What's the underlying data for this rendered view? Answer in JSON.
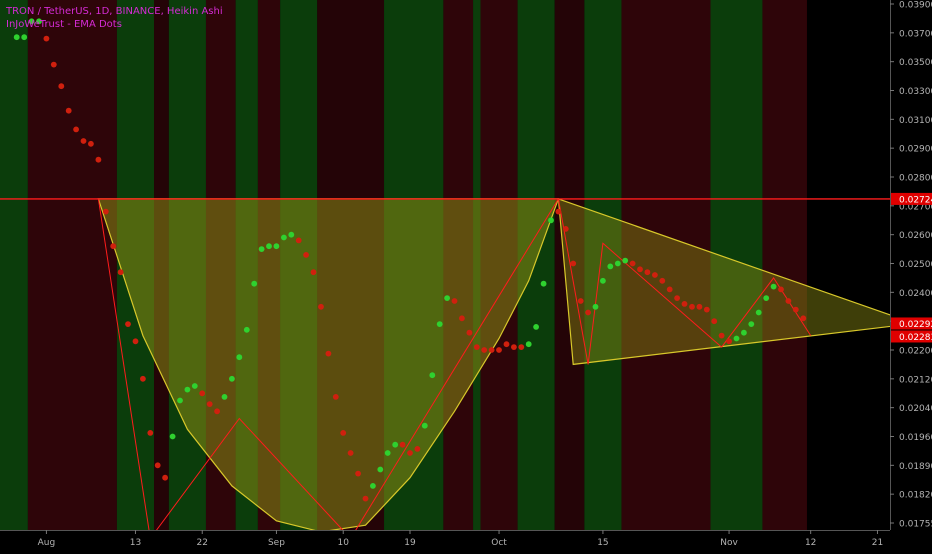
{
  "header": {
    "symbol_line": "TRON / TetherUS, 1D, BINANCE, Heikin Ashi",
    "indicator_line": "InJoWeTrust - EMA Dots"
  },
  "colors": {
    "text_magenta": "#d42bd4",
    "axis_text": "#b3b3b3",
    "dot_green": "#2fd12f",
    "dot_red": "#d0200e",
    "band_green": "#0b3d0b",
    "band_green_bright": "#0f4a10",
    "band_red": "#2e0509",
    "band_red_dark": "#240407",
    "resistance": "#ff1c1c",
    "cup_fill": "#8a8a14",
    "pattern_stroke": "#d8c82a",
    "price_badge": "#e00000"
  },
  "chart_data": {
    "type": "scatter",
    "title": "",
    "series": [
      {
        "name": "",
        "kind": "Heikin Ashi EMA dots"
      }
    ],
    "y_axis": {
      "position": "right",
      "range": [
        0.01735,
        0.0391
      ],
      "tick_labels": [
        "0.03900",
        "0.03700",
        "0.03500",
        "0.03300",
        "0.03100",
        "0.02900",
        "0.02800",
        "0.02700",
        "0.02600",
        "0.02500",
        "0.02400",
        "0.02300",
        "0.02200",
        "0.02120",
        "0.02040",
        "0.01960",
        "0.01890",
        "0.01820",
        "0.01755"
      ],
      "tick_values": [
        0.039,
        0.037,
        0.035,
        0.033,
        0.031,
        0.029,
        0.028,
        0.027,
        0.026,
        0.025,
        0.024,
        0.023,
        0.022,
        0.0212,
        0.0204,
        0.0196,
        0.0189,
        0.0182,
        0.01755
      ],
      "price_badges": [
        "0.02724",
        "0.02292",
        "0.02283"
      ],
      "price_badge_values": [
        0.02724,
        0.02292,
        0.02283
      ]
    },
    "x_axis": {
      "labels": [
        "Aug",
        "13",
        "22",
        "Sep",
        "10",
        "19",
        "Oct",
        "15",
        "Nov",
        "12",
        "21"
      ],
      "label_dates": [
        "2018-08-01",
        "2018-08-13",
        "2018-08-22",
        "2018-09-01",
        "2018-09-10",
        "2018-09-19",
        "2018-10-01",
        "2018-10-15",
        "2018-11-01",
        "2018-11-12",
        "2018-11-21"
      ]
    },
    "horizontal_line": {
      "value": 0.02724
    },
    "background_bands": [
      {
        "from": "2018-07-28",
        "to": "2018-07-30",
        "color": "green"
      },
      {
        "from": "2018-07-30",
        "to": "2018-08-11",
        "color": "red"
      },
      {
        "from": "2018-08-11",
        "to": "2018-08-16",
        "color": "green"
      },
      {
        "from": "2018-08-16",
        "to": "2018-08-18",
        "color": "red"
      },
      {
        "from": "2018-08-18",
        "to": "2018-08-23",
        "color": "green"
      },
      {
        "from": "2018-08-23",
        "to": "2018-08-27",
        "color": "red"
      },
      {
        "from": "2018-08-27",
        "to": "2018-08-30",
        "color": "green"
      },
      {
        "from": "2018-08-30",
        "to": "2018-09-02",
        "color": "red"
      },
      {
        "from": "2018-09-02",
        "to": "2018-09-07",
        "color": "green"
      },
      {
        "from": "2018-09-07",
        "to": "2018-09-16",
        "color": "red"
      },
      {
        "from": "2018-09-16",
        "to": "2018-09-24",
        "color": "green"
      },
      {
        "from": "2018-09-24",
        "to": "2018-09-28",
        "color": "red"
      },
      {
        "from": "2018-09-28",
        "to": "2018-09-29",
        "color": "green"
      },
      {
        "from": "2018-09-29",
        "to": "2018-10-04",
        "color": "red"
      },
      {
        "from": "2018-10-04",
        "to": "2018-10-09",
        "color": "green"
      },
      {
        "from": "2018-10-09",
        "to": "2018-10-13",
        "color": "red"
      },
      {
        "from": "2018-10-13",
        "to": "2018-10-18",
        "color": "green"
      },
      {
        "from": "2018-10-18",
        "to": "2018-10-30",
        "color": "red"
      },
      {
        "from": "2018-10-30",
        "to": "2018-11-06",
        "color": "green"
      },
      {
        "from": "2018-11-06",
        "to": "2018-11-12",
        "color": "red"
      }
    ],
    "dots": [
      {
        "date": "2018-07-28",
        "value": 0.0367,
        "color": "green"
      },
      {
        "date": "2018-07-29",
        "value": 0.0367,
        "color": "green"
      },
      {
        "date": "2018-07-30",
        "value": 0.0378,
        "color": "green"
      },
      {
        "date": "2018-07-31",
        "value": 0.0378,
        "color": "green"
      },
      {
        "date": "2018-08-01",
        "value": 0.0366,
        "color": "red"
      },
      {
        "date": "2018-08-02",
        "value": 0.0348,
        "color": "red"
      },
      {
        "date": "2018-08-03",
        "value": 0.0333,
        "color": "red"
      },
      {
        "date": "2018-08-04",
        "value": 0.0316,
        "color": "red"
      },
      {
        "date": "2018-08-05",
        "value": 0.0303,
        "color": "red"
      },
      {
        "date": "2018-08-06",
        "value": 0.0295,
        "color": "red"
      },
      {
        "date": "2018-08-07",
        "value": 0.0293,
        "color": "red"
      },
      {
        "date": "2018-08-08",
        "value": 0.0286,
        "color": "red"
      },
      {
        "date": "2018-08-09",
        "value": 0.0268,
        "color": "red"
      },
      {
        "date": "2018-08-10",
        "value": 0.0256,
        "color": "red"
      },
      {
        "date": "2018-08-11",
        "value": 0.0247,
        "color": "red"
      },
      {
        "date": "2018-08-12",
        "value": 0.0229,
        "color": "red"
      },
      {
        "date": "2018-08-13",
        "value": 0.0223,
        "color": "red"
      },
      {
        "date": "2018-08-14",
        "value": 0.0212,
        "color": "red"
      },
      {
        "date": "2018-08-15",
        "value": 0.0197,
        "color": "red"
      },
      {
        "date": "2018-08-16",
        "value": 0.0189,
        "color": "red"
      },
      {
        "date": "2018-08-17",
        "value": 0.0186,
        "color": "red"
      },
      {
        "date": "2018-08-18",
        "value": 0.0196,
        "color": "green"
      },
      {
        "date": "2018-08-19",
        "value": 0.0206,
        "color": "green"
      },
      {
        "date": "2018-08-20",
        "value": 0.0209,
        "color": "green"
      },
      {
        "date": "2018-08-21",
        "value": 0.021,
        "color": "green"
      },
      {
        "date": "2018-08-22",
        "value": 0.0208,
        "color": "red"
      },
      {
        "date": "2018-08-23",
        "value": 0.0205,
        "color": "red"
      },
      {
        "date": "2018-08-24",
        "value": 0.0203,
        "color": "red"
      },
      {
        "date": "2018-08-25",
        "value": 0.0207,
        "color": "green"
      },
      {
        "date": "2018-08-26",
        "value": 0.0212,
        "color": "green"
      },
      {
        "date": "2018-08-27",
        "value": 0.0218,
        "color": "green"
      },
      {
        "date": "2018-08-28",
        "value": 0.0227,
        "color": "green"
      },
      {
        "date": "2018-08-29",
        "value": 0.0243,
        "color": "green"
      },
      {
        "date": "2018-08-30",
        "value": 0.0255,
        "color": "green"
      },
      {
        "date": "2018-08-31",
        "value": 0.0256,
        "color": "green"
      },
      {
        "date": "2018-09-01",
        "value": 0.0256,
        "color": "green"
      },
      {
        "date": "2018-09-02",
        "value": 0.0259,
        "color": "green"
      },
      {
        "date": "2018-09-03",
        "value": 0.026,
        "color": "green"
      },
      {
        "date": "2018-09-04",
        "value": 0.0258,
        "color": "red"
      },
      {
        "date": "2018-09-05",
        "value": 0.0253,
        "color": "red"
      },
      {
        "date": "2018-09-06",
        "value": 0.0247,
        "color": "red"
      },
      {
        "date": "2018-09-07",
        "value": 0.0235,
        "color": "red"
      },
      {
        "date": "2018-09-08",
        "value": 0.0219,
        "color": "red"
      },
      {
        "date": "2018-09-09",
        "value": 0.0207,
        "color": "red"
      },
      {
        "date": "2018-09-10",
        "value": 0.0197,
        "color": "red"
      },
      {
        "date": "2018-09-11",
        "value": 0.0192,
        "color": "red"
      },
      {
        "date": "2018-09-12",
        "value": 0.0187,
        "color": "red"
      },
      {
        "date": "2018-09-13",
        "value": 0.0181,
        "color": "red"
      },
      {
        "date": "2018-09-14",
        "value": 0.0184,
        "color": "green"
      },
      {
        "date": "2018-09-15",
        "value": 0.0188,
        "color": "green"
      },
      {
        "date": "2018-09-16",
        "value": 0.0192,
        "color": "green"
      },
      {
        "date": "2018-09-17",
        "value": 0.0194,
        "color": "green"
      },
      {
        "date": "2018-09-18",
        "value": 0.0194,
        "color": "red"
      },
      {
        "date": "2018-09-19",
        "value": 0.0192,
        "color": "red"
      },
      {
        "date": "2018-09-20",
        "value": 0.0193,
        "color": "red"
      },
      {
        "date": "2018-09-21",
        "value": 0.0199,
        "color": "green"
      },
      {
        "date": "2018-09-22",
        "value": 0.0213,
        "color": "green"
      },
      {
        "date": "2018-09-23",
        "value": 0.0229,
        "color": "green"
      },
      {
        "date": "2018-09-24",
        "value": 0.0238,
        "color": "green"
      },
      {
        "date": "2018-09-25",
        "value": 0.0237,
        "color": "red"
      },
      {
        "date": "2018-09-26",
        "value": 0.0231,
        "color": "red"
      },
      {
        "date": "2018-09-27",
        "value": 0.0226,
        "color": "red"
      },
      {
        "date": "2018-09-28",
        "value": 0.0221,
        "color": "red"
      },
      {
        "date": "2018-09-29",
        "value": 0.022,
        "color": "red"
      },
      {
        "date": "2018-09-30",
        "value": 0.022,
        "color": "red"
      },
      {
        "date": "2018-10-01",
        "value": 0.022,
        "color": "red"
      },
      {
        "date": "2018-10-02",
        "value": 0.0222,
        "color": "red"
      },
      {
        "date": "2018-10-03",
        "value": 0.0221,
        "color": "red"
      },
      {
        "date": "2018-10-04",
        "value": 0.0221,
        "color": "red"
      },
      {
        "date": "2018-10-05",
        "value": 0.0222,
        "color": "green"
      },
      {
        "date": "2018-10-06",
        "value": 0.0228,
        "color": "green"
      },
      {
        "date": "2018-10-07",
        "value": 0.0243,
        "color": "green"
      },
      {
        "date": "2018-10-08",
        "value": 0.0265,
        "color": "green"
      },
      {
        "date": "2018-10-09",
        "value": 0.0268,
        "color": "red"
      },
      {
        "date": "2018-10-10",
        "value": 0.0262,
        "color": "red"
      },
      {
        "date": "2018-10-11",
        "value": 0.025,
        "color": "red"
      },
      {
        "date": "2018-10-12",
        "value": 0.0237,
        "color": "red"
      },
      {
        "date": "2018-10-13",
        "value": 0.0233,
        "color": "red"
      },
      {
        "date": "2018-10-14",
        "value": 0.0235,
        "color": "green"
      },
      {
        "date": "2018-10-15",
        "value": 0.0244,
        "color": "green"
      },
      {
        "date": "2018-10-16",
        "value": 0.0249,
        "color": "green"
      },
      {
        "date": "2018-10-17",
        "value": 0.025,
        "color": "green"
      },
      {
        "date": "2018-10-18",
        "value": 0.0251,
        "color": "green"
      },
      {
        "date": "2018-10-19",
        "value": 0.025,
        "color": "red"
      },
      {
        "date": "2018-10-20",
        "value": 0.0248,
        "color": "red"
      },
      {
        "date": "2018-10-21",
        "value": 0.0247,
        "color": "red"
      },
      {
        "date": "2018-10-22",
        "value": 0.0246,
        "color": "red"
      },
      {
        "date": "2018-10-23",
        "value": 0.0244,
        "color": "red"
      },
      {
        "date": "2018-10-24",
        "value": 0.0241,
        "color": "red"
      },
      {
        "date": "2018-10-25",
        "value": 0.0238,
        "color": "red"
      },
      {
        "date": "2018-10-26",
        "value": 0.0236,
        "color": "red"
      },
      {
        "date": "2018-10-27",
        "value": 0.0235,
        "color": "red"
      },
      {
        "date": "2018-10-28",
        "value": 0.0235,
        "color": "red"
      },
      {
        "date": "2018-10-29",
        "value": 0.0234,
        "color": "red"
      },
      {
        "date": "2018-10-30",
        "value": 0.023,
        "color": "red"
      },
      {
        "date": "2018-10-31",
        "value": 0.0225,
        "color": "red"
      },
      {
        "date": "2018-11-01",
        "value": 0.0223,
        "color": "red"
      },
      {
        "date": "2018-11-02",
        "value": 0.0224,
        "color": "green"
      },
      {
        "date": "2018-11-03",
        "value": 0.0226,
        "color": "green"
      },
      {
        "date": "2018-11-04",
        "value": 0.0229,
        "color": "green"
      },
      {
        "date": "2018-11-05",
        "value": 0.0233,
        "color": "green"
      },
      {
        "date": "2018-11-06",
        "value": 0.0238,
        "color": "green"
      },
      {
        "date": "2018-11-07",
        "value": 0.0242,
        "color": "green"
      },
      {
        "date": "2018-11-08",
        "value": 0.0241,
        "color": "red"
      },
      {
        "date": "2018-11-09",
        "value": 0.0237,
        "color": "red"
      },
      {
        "date": "2018-11-10",
        "value": 0.0234,
        "color": "red"
      },
      {
        "date": "2018-11-11",
        "value": 0.0231,
        "color": "red"
      }
    ],
    "drawings": {
      "cup_curve": [
        {
          "date": "2018-08-08",
          "value": 0.02724
        },
        {
          "date": "2018-08-14",
          "value": 0.0225
        },
        {
          "date": "2018-08-20",
          "value": 0.0198
        },
        {
          "date": "2018-08-26",
          "value": 0.0184
        },
        {
          "date": "2018-09-01",
          "value": 0.0176
        },
        {
          "date": "2018-09-07",
          "value": 0.01735
        },
        {
          "date": "2018-09-13",
          "value": 0.0175
        },
        {
          "date": "2018-09-19",
          "value": 0.0186
        },
        {
          "date": "2018-09-25",
          "value": 0.0203
        },
        {
          "date": "2018-10-01",
          "value": 0.0224
        },
        {
          "date": "2018-10-05",
          "value": 0.0244
        },
        {
          "date": "2018-10-09",
          "value": 0.02724
        }
      ],
      "triangle": [
        {
          "date": "2018-10-09",
          "value": 0.02724
        },
        {
          "date": "2018-11-26",
          "value": 0.02292
        },
        {
          "date": "2018-10-11",
          "value": 0.0216
        }
      ],
      "red_zigzag_cup": [
        {
          "date": "2018-08-08",
          "value": 0.02724
        },
        {
          "date": "2018-08-15",
          "value": 0.0172
        },
        {
          "date": "2018-08-27",
          "value": 0.0201
        },
        {
          "date": "2018-09-11",
          "value": 0.0172
        },
        {
          "date": "2018-10-09",
          "value": 0.02724
        }
      ],
      "red_zigzag_triangle": [
        {
          "date": "2018-10-09",
          "value": 0.02724
        },
        {
          "date": "2018-10-13",
          "value": 0.0216
        },
        {
          "date": "2018-10-15",
          "value": 0.0257
        },
        {
          "date": "2018-10-31",
          "value": 0.0221
        },
        {
          "date": "2018-11-07",
          "value": 0.0245
        },
        {
          "date": "2018-11-12",
          "value": 0.0225
        }
      ]
    }
  }
}
